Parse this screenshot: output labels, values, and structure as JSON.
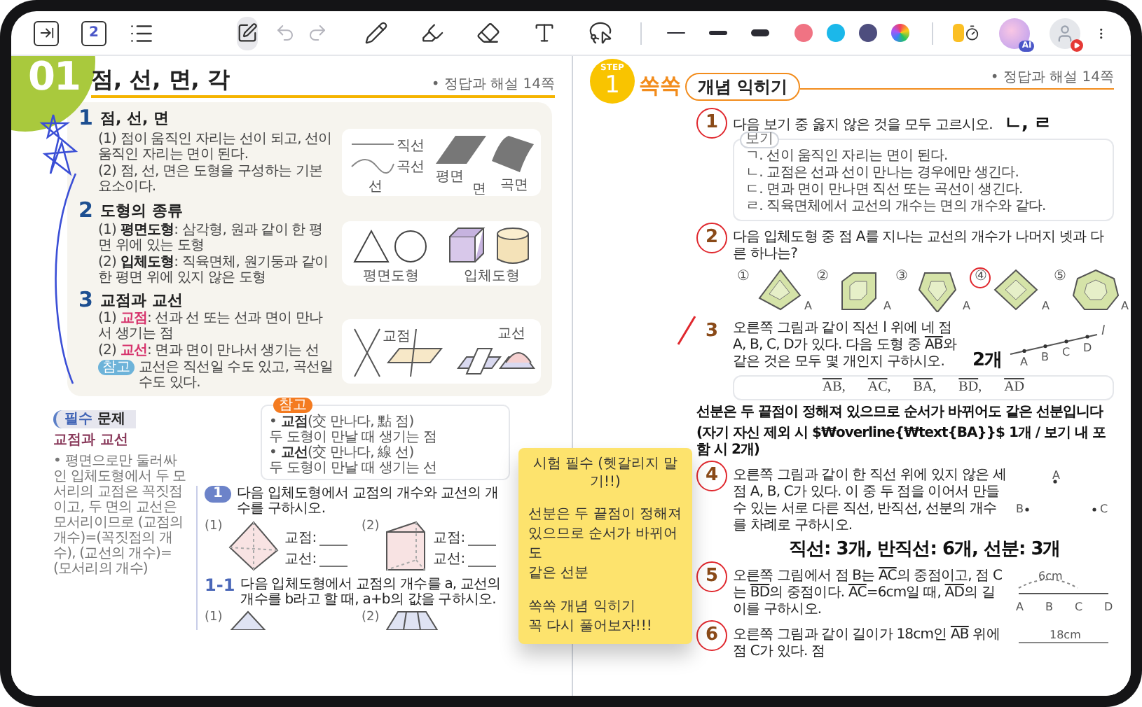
{
  "toolbar": {
    "left_tools": [
      {
        "kind": "panel"
      },
      {
        "kind": "page",
        "label": "2"
      },
      {
        "kind": "outline"
      }
    ],
    "pen_mode": {
      "selected": true
    },
    "history": [
      {
        "kind": "undo",
        "disabled": true
      },
      {
        "kind": "redo",
        "disabled": true
      }
    ],
    "tools": [
      {
        "kind": "pencil",
        "selected": false
      },
      {
        "kind": "highlighter",
        "selected": false
      },
      {
        "kind": "eraser",
        "selected": false
      },
      {
        "kind": "text",
        "selected": false
      },
      {
        "kind": "lasso",
        "selected": false
      }
    ],
    "stroke_widths": [
      {
        "kind": "thin",
        "selected": false
      },
      {
        "kind": "medium",
        "selected": false
      },
      {
        "kind": "thick",
        "selected": false
      }
    ],
    "colors": [
      {
        "color": "#f07383",
        "selected": false
      },
      {
        "color": "#1bb8ea",
        "selected": false
      },
      {
        "color": "#4e4e7e",
        "selected": false
      }
    ],
    "ai_badge": "AI"
  },
  "left_page": {
    "chapter_number": "01",
    "title": "점, 선, 면, 각",
    "answer_ref": "• 정답과 해설 14쪽",
    "sections": [
      {
        "number": "1",
        "title": "점, 선, 면",
        "items": [
          {
            "marker": "(1)",
            "text": "점이 움직인 자리는 선이 되고, 선이 움직인 자리는 면이 된다."
          },
          {
            "marker": "(2)",
            "text": "점, 선, 면은 도형을 구성하는 기본 요소이다."
          }
        ],
        "figure": {
          "kind": "point-line-plane",
          "labels": [
            "직선",
            "곡선",
            "선",
            "평면",
            "면",
            "곡면"
          ]
        }
      },
      {
        "number": "2",
        "title": "도형의 종류",
        "items": [
          {
            "marker": "(1)",
            "term": "평면도형",
            "text": ": 삼각형, 원과 같이 한 평면 위에 있는 도형",
            "highlight": false
          },
          {
            "marker": "(2)",
            "term": "입체도형",
            "text": ": 직육면체, 원기둥과 같이 한 평면 위에 있지 않은 도형",
            "highlight": false
          }
        ],
        "figure": {
          "kind": "shape-types",
          "labels": [
            "평면도형",
            "입체도형"
          ]
        }
      },
      {
        "number": "3",
        "title": "교점과 교선",
        "items": [
          {
            "marker": "(1)",
            "term": "교점",
            "text": ": 선과 선 또는 선과 면이 만나서 생기는 점",
            "highlight": true
          },
          {
            "marker": "(2)",
            "term": "교선",
            "text": ": 면과 면이 만나서 생기는 선",
            "highlight": true
          }
        ],
        "note": {
          "badge": "참고",
          "text": "교선은 직선일 수도 있고, 곡선일 수도 있다."
        },
        "figure": {
          "kind": "intersections",
          "labels": [
            "교점",
            "교선"
          ]
        }
      }
    ],
    "side_note": {
      "badge": "참고",
      "entries": [
        {
          "bullet": "•",
          "term": "교점",
          "gloss": "(交 만나다, 點 점)",
          "text": "두 도형이 만날 때 생기는 점"
        },
        {
          "bullet": "•",
          "term": "교선",
          "gloss": "(交 만나다, 線 선)",
          "text": "두 도형이 만날 때 생기는 선"
        }
      ]
    },
    "practice": {
      "tag_1": "필수",
      "tag_2": "문제",
      "topic": "교점과 교선",
      "tip": "• 평면으로만 둘러싸인 입체도형에서 두 모서리의 교점은 꼭짓점이고, 두 면의 교선은 모서리이므로 (교점의 개수)=(꼭짓점의 개수), (교선의 개수)=(모서리의 개수)",
      "problems": [
        {
          "kind": "main",
          "number": "1",
          "text": "다음 입체도형에서 교점의 개수와 교선의 개수를 구하시오.",
          "parts": [
            {
              "marker": "(1)",
              "kind": "pyramid",
              "blanks": [
                "교점:",
                "교선:"
              ]
            },
            {
              "marker": "(2)",
              "kind": "prism",
              "blanks": [
                "교점:",
                "교선:"
              ]
            }
          ]
        },
        {
          "kind": "similar",
          "number": "1-1",
          "text": "다음 입체도형에서 교점의 개수를 a, 교선의 개수를 b라고 할 때, a+b의 값을 구하시오.",
          "parts": [
            {
              "marker": "(1)",
              "kind": "pyramid-top"
            },
            {
              "marker": "(2)",
              "kind": "frustum-top"
            }
          ]
        }
      ]
    }
  },
  "right_page": {
    "step_label": "STEP",
    "step_number": "1",
    "brand": "쏙쏙",
    "title": "개념 익히기",
    "answer_ref": "• 정답과 해설 14쪽",
    "questions": [
      {
        "number": "1",
        "kind": "circle",
        "text": [
          {
            "text": "다음 보기 중 옳지 않은 것을 모두 고르시오."
          }
        ],
        "answer": "ㄴ, ㄹ",
        "box": {
          "label": "보기",
          "lines": [
            "ㄱ. 선이 움직인 자리는 면이 된다.",
            "ㄴ. 교점은 선과 선이 만나는 경우에만 생긴다.",
            "ㄷ. 면과 면이 만나면 직선 또는 곡선이 생긴다.",
            "ㄹ. 직육면체에서 교선의 개수는 면의 개수와 같다."
          ]
        }
      },
      {
        "number": "2",
        "kind": "circle",
        "text": [
          {
            "text": "다음 입체도형 중 점 A를 지나는 교선의 개수가 나머지 넷과 다른 하나는?"
          }
        ],
        "choices": [
          {
            "label": "①",
            "kind": "pyramid",
            "vertex": "A",
            "selected": false
          },
          {
            "label": "②",
            "kind": "cube",
            "vertex": "A",
            "selected": false
          },
          {
            "label": "③",
            "kind": "bipyramid",
            "vertex": "A",
            "selected": false
          },
          {
            "label": "④",
            "kind": "octahedron",
            "vertex": "A",
            "selected": true
          },
          {
            "label": "⑤",
            "kind": "dodecahedron",
            "vertex": "A",
            "selected": false
          }
        ]
      },
      {
        "number": "3",
        "kind": "check",
        "text": [
          {
            "text": "오른쪽 그림과 같이 직선 l 위에 네 점 A, B, C, D가 있다. 다음 도형 중 "
          },
          {
            "text": "AB",
            "overline": true
          },
          {
            "text": "와 같은 것은 모두 몇 개인지 구하시오."
          }
        ],
        "answer": "2개",
        "figure": {
          "kind": "line-points",
          "labels": [
            "A",
            "B",
            "C",
            "D"
          ],
          "line_label": "l"
        },
        "items": [
          {
            "text": "AB",
            "punct": ","
          },
          {
            "text": "AC",
            "punct": ","
          },
          {
            "text": "BA",
            "punct": ","
          },
          {
            "text": "BD",
            "punct": ","
          },
          {
            "text": "AD"
          }
        ],
        "notes": [
          "선분은 두 끝점이 정해져 있으므로 순서가 바뀌어도 같은 선분입니다",
          "(자기 자신 제외 시 $₩overline{₩text{BA}}$ 1개 / 보기 내 포함 시 2개)"
        ]
      },
      {
        "number": "4",
        "kind": "circle",
        "text": [
          {
            "text": "오른쪽 그림과 같이 한 직선 위에 있지 않은 세 점 A, B, C가 있다. 이 중 두 점을 이어서 만들 수 있는 서로 다른 직선, 반직선, 선분의 개수를 차례로 구하시오."
          }
        ],
        "answer_below": "직선: 3개, 반직선: 6개, 선분: 3개",
        "figure": {
          "kind": "triangle-points",
          "labels": [
            "A",
            "B",
            "C"
          ]
        }
      },
      {
        "number": "5",
        "kind": "circle",
        "text": [
          {
            "text": "오른쪽 그림에서 점 B는 "
          },
          {
            "text": "AC",
            "overline": true
          },
          {
            "text": "의 중점이고, 점 C는 "
          },
          {
            "text": "BD",
            "overline": true
          },
          {
            "text": "의 중점이다. "
          },
          {
            "text": "AC",
            "overline": true
          },
          {
            "text": "=6cm일 때, "
          },
          {
            "text": "AD",
            "overline": true
          },
          {
            "text": "의 길이를 구하시오."
          }
        ],
        "figure": {
          "kind": "segment-points",
          "labels": [
            "A",
            "B",
            "C",
            "D"
          ],
          "measure": "6cm"
        }
      },
      {
        "number": "6",
        "kind": "circle",
        "text": [
          {
            "text": "오른쪽 그림과 같이 길이가 18cm인 "
          },
          {
            "text": "AB",
            "overline": true
          },
          {
            "text": " 위에 점 C가 있다. 점"
          }
        ],
        "figure": {
          "kind": "segment-measure",
          "measure": "18cm"
        }
      }
    ]
  },
  "sticky_note": {
    "title": "시험 필수 (헷갈리지 말기!!)",
    "paragraphs": [
      [
        "선분은 두 끝점이 정해져",
        "있으므로 순서가 바뀌어도",
        "같은 선분"
      ],
      [
        "쏙쏙 개념 익히기",
        "꼭 다시 풀어보자!!!"
      ]
    ]
  }
}
